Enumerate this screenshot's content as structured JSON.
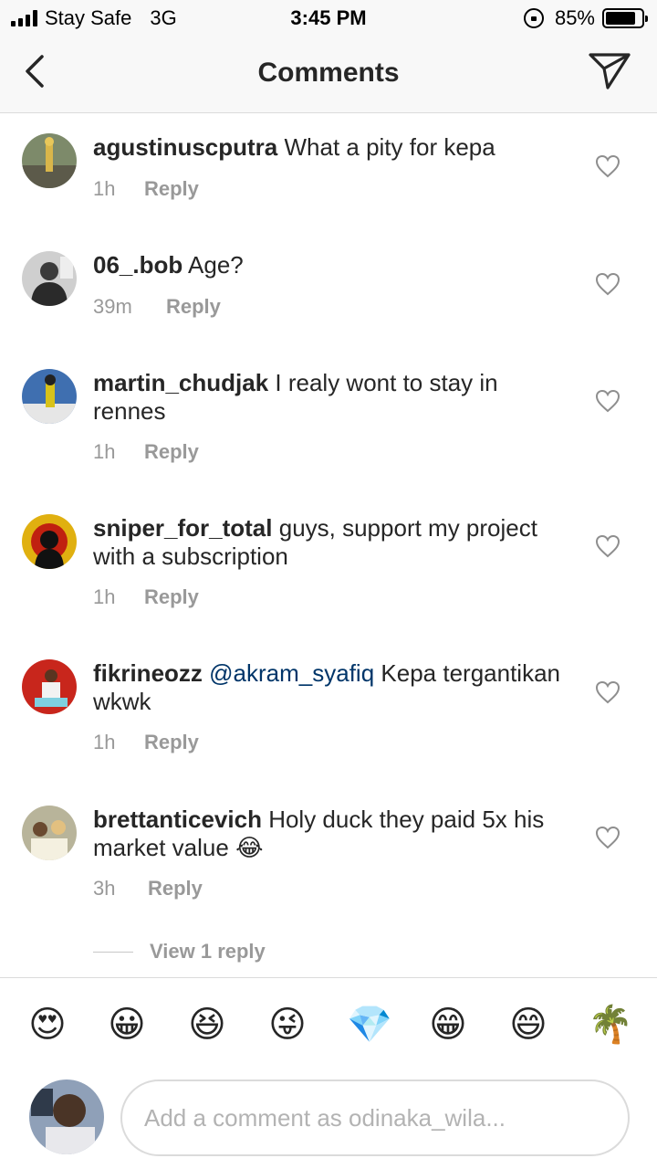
{
  "status_bar": {
    "carrier": "Stay Safe",
    "network": "3G",
    "time": "3:45 PM",
    "battery": "85%",
    "battery_level": 0.85
  },
  "nav": {
    "title": "Comments",
    "back_icon": "chevron-left-icon",
    "send_icon": "paper-plane-icon"
  },
  "comments": [
    {
      "user": "agustinuscputra",
      "text": "What a pity for kepa",
      "time": "1h",
      "reply": "Reply"
    },
    {
      "user": "06_.bob",
      "text": "Age?",
      "time": "39m",
      "reply": "Reply"
    },
    {
      "user": "martin_chudjak",
      "text": "I realy wont to stay in rennes",
      "time": "1h",
      "reply": "Reply"
    },
    {
      "user": "sniper_for_total",
      "text": "guys, support my project with a subscription",
      "time": "1h",
      "reply": "Reply"
    },
    {
      "user": "fikrineozz",
      "mention": "@akram_syafiq",
      "text": "Kepa tergantikan wkwk",
      "time": "1h",
      "reply": "Reply"
    },
    {
      "user": "brettanticevich",
      "text": "Holy duck they paid 5x his market value",
      "emoji": "😂",
      "time": "3h",
      "reply": "Reply"
    }
  ],
  "view_replies": "View 1 reply",
  "emoji_bar": [
    "😍",
    "😀",
    "😆",
    "😜",
    "💎",
    "😁",
    "😄",
    "🌴"
  ],
  "composer": {
    "placeholder": "Add a comment as odinaka_wila..."
  },
  "colors": {
    "text": "#262626",
    "meta": "#999999",
    "mention": "#003569",
    "border": "#dbdbdb",
    "bar_bg": "#f8f8f8"
  }
}
